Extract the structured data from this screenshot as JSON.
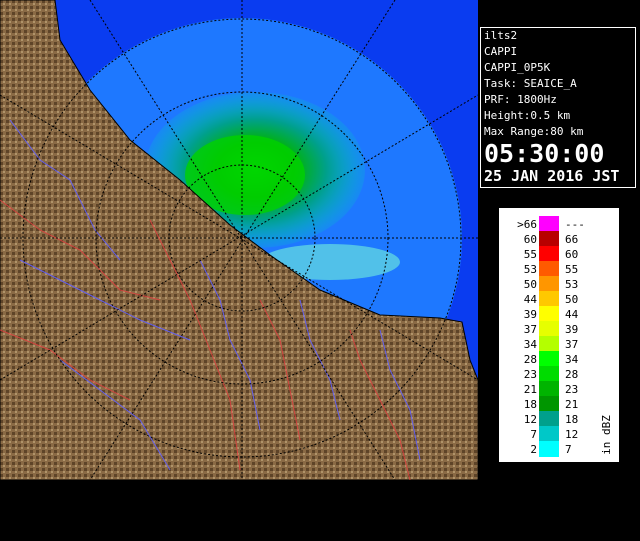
{
  "info": {
    "site": "ilts2",
    "product": "CAPPI",
    "product_name": "CAPPI_0P5K",
    "task": "Task: SEAICE_A",
    "prf": "PRF: 1800Hz",
    "height": "Height:0.5 km",
    "max_range": "Max Range:80 km",
    "time": "05:30:00",
    "date": "25 JAN 2016 JST"
  },
  "legend": {
    "title": "Reflectivity in dBZ",
    "rows": [
      {
        "lo": ">66",
        "hi": "---",
        "color": "#ff00ff"
      },
      {
        "lo": "60",
        "hi": "66",
        "color": "#b80000"
      },
      {
        "lo": "55",
        "hi": "60",
        "color": "#ff0000"
      },
      {
        "lo": "53",
        "hi": "55",
        "color": "#ff5a00"
      },
      {
        "lo": "50",
        "hi": "53",
        "color": "#ff9600"
      },
      {
        "lo": "44",
        "hi": "50",
        "color": "#ffc800"
      },
      {
        "lo": "39",
        "hi": "44",
        "color": "#ffff00"
      },
      {
        "lo": "37",
        "hi": "39",
        "color": "#e6ff00"
      },
      {
        "lo": "34",
        "hi": "37",
        "color": "#b4ff00"
      },
      {
        "lo": "28",
        "hi": "34",
        "color": "#00ff00"
      },
      {
        "lo": "23",
        "hi": "28",
        "color": "#00dc00"
      },
      {
        "lo": "21",
        "hi": "23",
        "color": "#00b400"
      },
      {
        "lo": "18",
        "hi": "21",
        "color": "#009600"
      },
      {
        "lo": "12",
        "hi": "18",
        "color": "#00a08c"
      },
      {
        "lo": "7",
        "hi": "12",
        "color": "#00c8c8"
      },
      {
        "lo": "2",
        "hi": "7",
        "color": "#00ffff"
      }
    ]
  },
  "colors": {
    "sea": "#0a3cf0",
    "radar_coverage": "#1e78ff",
    "land": "#7a5a3a"
  }
}
